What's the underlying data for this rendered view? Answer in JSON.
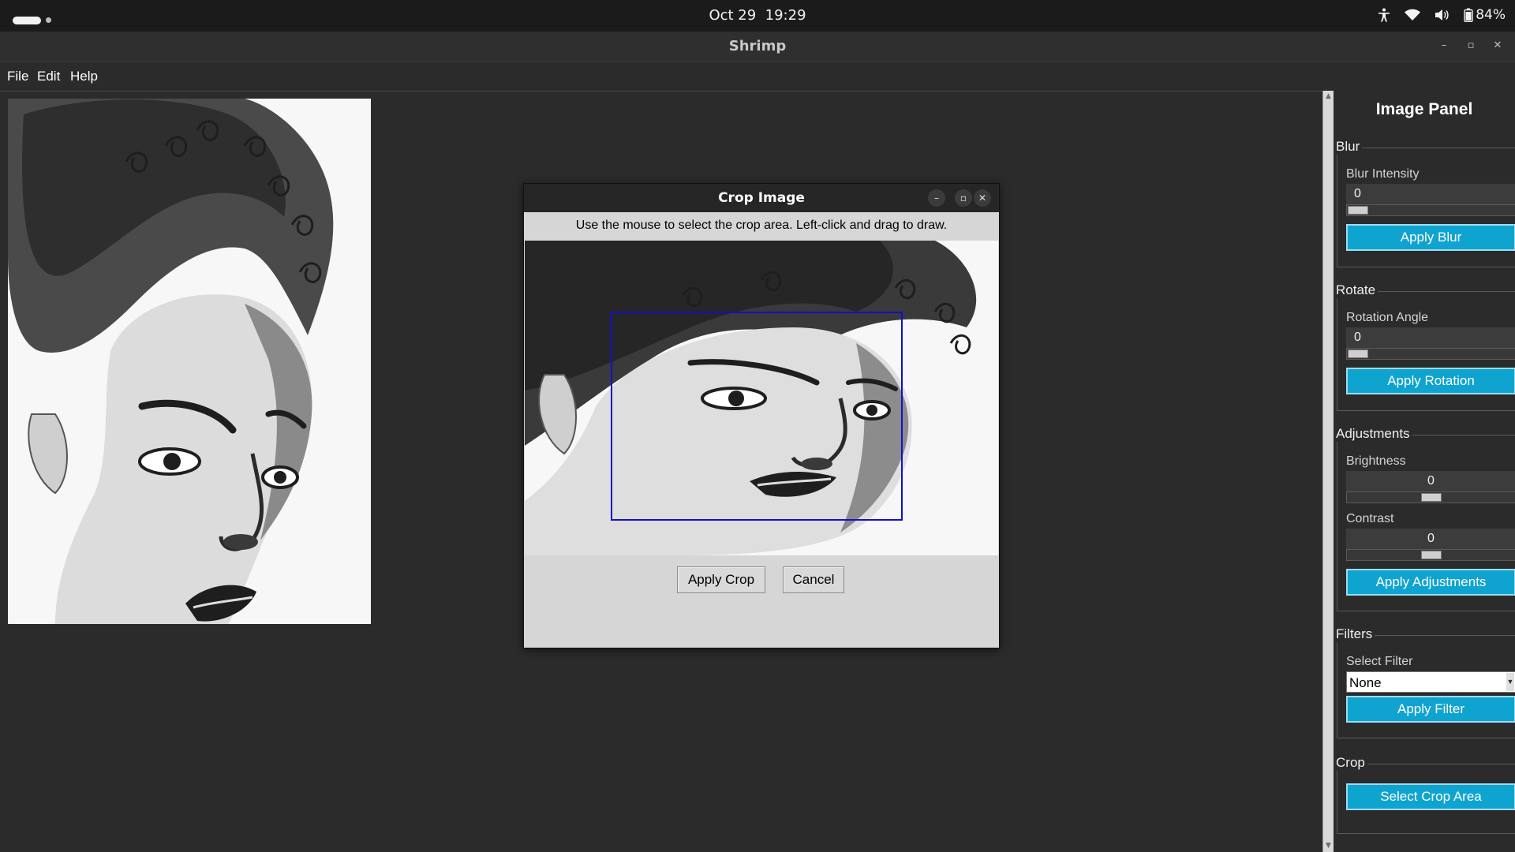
{
  "system_bar": {
    "date": "Oct 29",
    "time": "19:29",
    "battery": "84%"
  },
  "window": {
    "title": "Shrimp"
  },
  "menu": {
    "file": "File",
    "edit": "Edit",
    "help": "Help"
  },
  "panel": {
    "title": "Image Panel",
    "blur": {
      "legend": "Blur",
      "label": "Blur Intensity",
      "value": "0",
      "button": "Apply Blur"
    },
    "rotate": {
      "legend": "Rotate",
      "label": "Rotation Angle",
      "value": "0",
      "button": "Apply Rotation"
    },
    "adjustments": {
      "legend": "Adjustments",
      "brightness_label": "Brightness",
      "brightness_value": "0",
      "contrast_label": "Contrast",
      "contrast_value": "0",
      "button": "Apply Adjustments"
    },
    "filters": {
      "legend": "Filters",
      "label": "Select Filter",
      "selected": "None",
      "button": "Apply Filter"
    },
    "crop": {
      "legend": "Crop",
      "button": "Select Crop Area"
    }
  },
  "dialog": {
    "title": "Crop Image",
    "instruction": "Use the mouse to select the crop area. Left-click and drag to draw.",
    "apply_button": "Apply Crop",
    "cancel_button": "Cancel"
  },
  "colors": {
    "accent_button": "#0fa4cf",
    "crop_rect": "#1010c8",
    "background": "#2b2b2b"
  }
}
